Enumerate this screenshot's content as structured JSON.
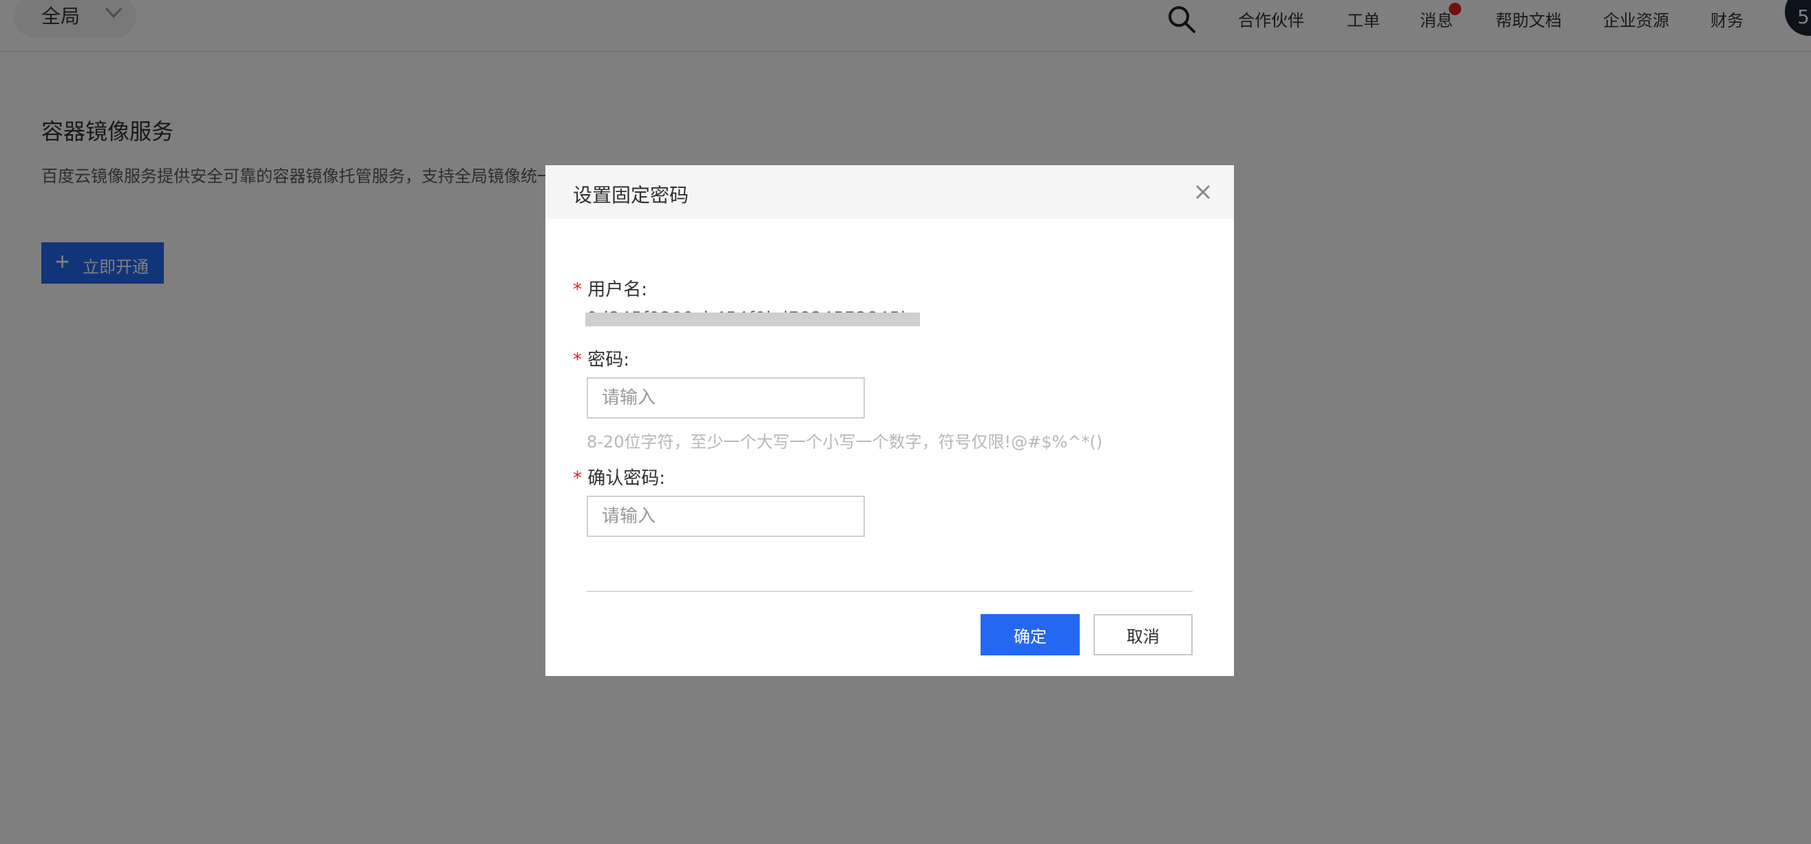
{
  "header": {
    "region": "全局",
    "nav": [
      "合作伙伴",
      "工单",
      "消息",
      "帮助文档",
      "企业资源",
      "财务"
    ],
    "avatar_text": "5",
    "icons": {
      "search": "search-icon",
      "region_toggle": "chevron-down-icon"
    }
  },
  "main": {
    "title": "容器镜像服务",
    "description": "百度云镜像服务提供安全可靠的容器镜像托管服务，支持全局镜像统一……镜像版本、并在任何地方通过网络拉取和使用这些镜像。",
    "activate_label": "立即开通"
  },
  "modal": {
    "title": "设置固定密码",
    "required_mark": "*",
    "username_label": "用户名:",
    "username_value": "0d345f9200cb454f0bd7834573845b",
    "password_label": "密码:",
    "password_placeholder": "请输入",
    "password_hint": "8-20位字符，至少一个大写一个小写一个数字，符号仅限!@#$%^*()",
    "confirm_label": "确认密码:",
    "confirm_placeholder": "请输入",
    "ok_button": "确定",
    "cancel_button": "取消"
  },
  "colors": {
    "primary": "#2468f2",
    "required": "#e02020",
    "overlay": "rgba(0,0,0,0.5)"
  }
}
